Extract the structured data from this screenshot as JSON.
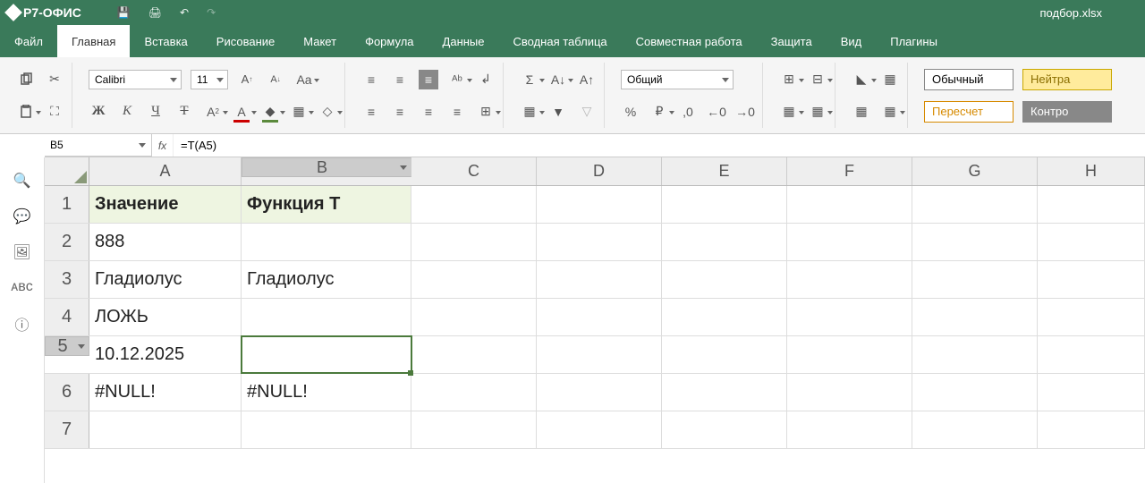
{
  "app": {
    "name": "Р7-ОФИС",
    "doc_title": "подбор.xlsx"
  },
  "titlebar_icons": [
    "save-icon",
    "print-icon",
    "undo-icon",
    "redo-icon"
  ],
  "menu": [
    "Файл",
    "Главная",
    "Вставка",
    "Рисование",
    "Макет",
    "Формула",
    "Данные",
    "Сводная таблица",
    "Совместная работа",
    "Защита",
    "Вид",
    "Плагины"
  ],
  "active_menu": 1,
  "ribbon": {
    "font_name": "Calibri",
    "font_size": "11",
    "inc_font": "A",
    "dec_font": "A",
    "case": "Aa",
    "bold": "Ж",
    "italic": "К",
    "under": "Ч",
    "strike": "Т",
    "sub": "A₂",
    "fontcolor": "A",
    "fill": "◆",
    "border": "⊞",
    "orient": "⭯",
    "number_format": "Общий",
    "percent": "%",
    "comma": ",0",
    "inc_dec": "←",
    "dec_dec": "→",
    "styles": {
      "normal": "Обычный",
      "neutral": "Нейтра",
      "calc": "Пересчет",
      "check": "Контро"
    }
  },
  "namebox": "B5",
  "fx": "fx",
  "formula": "=T(A5)",
  "columns": [
    "A",
    "B",
    "C",
    "D",
    "E",
    "F",
    "G",
    "H"
  ],
  "rows": [
    {
      "n": "1",
      "A": "Значение",
      "B": "Функция T",
      "hdr": true
    },
    {
      "n": "2",
      "A": "888",
      "B": ""
    },
    {
      "n": "3",
      "A": "Гладиолус",
      "B": "Гладиолус"
    },
    {
      "n": "4",
      "A": "ЛОЖЬ",
      "B": ""
    },
    {
      "n": "5",
      "A": "10.12.2025",
      "B": "",
      "active": "B"
    },
    {
      "n": "6",
      "A": "#NULL!",
      "B": "#NULL!"
    },
    {
      "n": "7",
      "A": "",
      "B": ""
    }
  ],
  "left_tools": [
    "🔍",
    "💬",
    "🖼",
    "ᴀʙᴄ",
    "ⓘ"
  ],
  "chart_data": {
    "type": "table",
    "columns": [
      "Значение",
      "Функция T"
    ],
    "rows": [
      [
        "888",
        ""
      ],
      [
        "Гладиолус",
        "Гладиолус"
      ],
      [
        "ЛОЖЬ",
        ""
      ],
      [
        "10.12.2025",
        ""
      ],
      [
        "#NULL!",
        "#NULL!"
      ]
    ]
  }
}
